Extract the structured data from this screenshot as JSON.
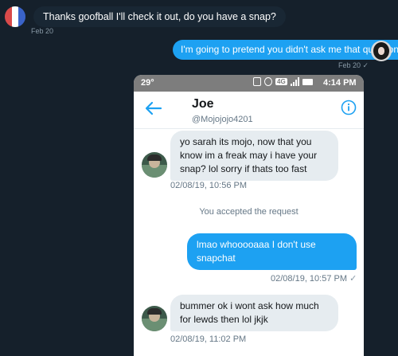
{
  "outer": {
    "incoming_text": "Thanks goofball I'll check it out, do you have a snap?",
    "incoming_time": "Feb 20",
    "outgoing_text": "I'm going to pretend you didn't ask me that question.",
    "outgoing_time": "Feb 20",
    "outgoing_check": "✓"
  },
  "status_bar": {
    "temperature": "29°",
    "network": "4G",
    "time": "4:14 PM"
  },
  "conversation": {
    "name": "Joe",
    "handle": "@Mojojojo4201"
  },
  "messages": [
    {
      "direction": "in",
      "text": "yo sarah its mojo, now that you know im a freak may i have your snap? lol sorry if thats too fast",
      "time": "02/08/19, 10:56 PM"
    },
    {
      "direction": "system",
      "text": "You accepted the request"
    },
    {
      "direction": "out",
      "text": "lmao whooooaaa I don't use snapchat",
      "time": "02/08/19, 10:57 PM",
      "check": "✓"
    },
    {
      "direction": "in",
      "text": "bummer ok i wont ask how much for lewds then lol jkjk",
      "time": "02/08/19, 11:02 PM"
    }
  ],
  "colors": {
    "background": "#15202b",
    "accent": "#1da1f2",
    "incoming_bubble": "#e6ecf0",
    "status_bar": "#7d7d7d"
  },
  "icons": [
    "back-arrow-icon",
    "info-icon",
    "vibrate-icon",
    "alarm-icon",
    "signal-icon",
    "battery-icon"
  ]
}
